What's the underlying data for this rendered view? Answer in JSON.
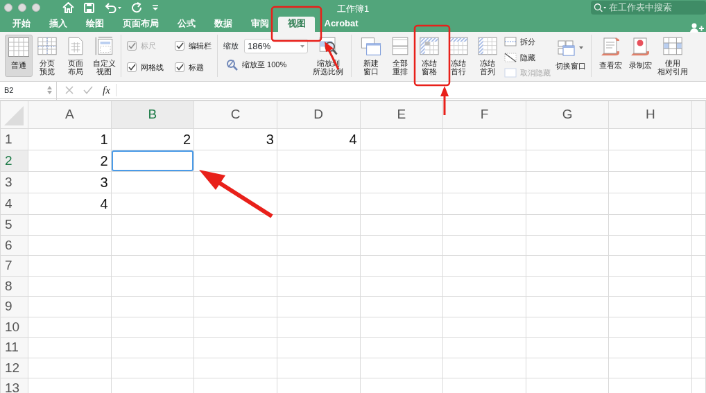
{
  "window": {
    "title": "工作簿1"
  },
  "search": {
    "placeholder": "在工作表中搜索"
  },
  "tabs": [
    {
      "label": "开始",
      "selected": false
    },
    {
      "label": "插入",
      "selected": false
    },
    {
      "label": "绘图",
      "selected": false
    },
    {
      "label": "页面布局",
      "selected": false
    },
    {
      "label": "公式",
      "selected": false
    },
    {
      "label": "数据",
      "selected": false
    },
    {
      "label": "审阅",
      "selected": false
    },
    {
      "label": "视图",
      "selected": true
    },
    {
      "label": "Acrobat",
      "selected": false
    }
  ],
  "ribbon": {
    "views": [
      {
        "lines": [
          "普通"
        ],
        "selected": true
      },
      {
        "lines": [
          "分页",
          "预览"
        ],
        "selected": false
      },
      {
        "lines": [
          "页面",
          "布局"
        ],
        "selected": false
      },
      {
        "lines": [
          "自定义",
          "视图"
        ],
        "selected": false
      }
    ],
    "show": [
      {
        "label": "标尺",
        "checked": true,
        "disabled": true
      },
      {
        "label": "编辑栏",
        "checked": true,
        "disabled": false
      },
      {
        "label": "网格线",
        "checked": true,
        "disabled": false
      },
      {
        "label": "标题",
        "checked": true,
        "disabled": false
      }
    ],
    "zoom": {
      "label": "缩放",
      "value": "186%",
      "reset": "缩放至 100%",
      "fit": [
        "缩放到",
        "所选比例"
      ]
    },
    "window_buttons": [
      {
        "lines": [
          "新建",
          "窗口"
        ]
      },
      {
        "lines": [
          "全部",
          "重排"
        ]
      },
      {
        "lines": [
          "冻结",
          "窗格"
        ]
      },
      {
        "lines": [
          "冻结",
          "首行"
        ]
      },
      {
        "lines": [
          "冻结",
          "首列"
        ]
      }
    ],
    "window_small": [
      {
        "label": "拆分",
        "disabled": false
      },
      {
        "label": "隐藏",
        "disabled": false
      },
      {
        "label": "取消隐藏",
        "disabled": true
      }
    ],
    "switch_windows": "切换窗口",
    "macros": [
      {
        "lines": [
          "查看宏"
        ]
      },
      {
        "lines": [
          "录制宏"
        ]
      },
      {
        "lines": [
          "使用",
          "相对引用"
        ]
      }
    ]
  },
  "formula_bar": {
    "name_box": "B2",
    "fx": "fx"
  },
  "sheet": {
    "columns": [
      {
        "label": "A",
        "selected": false
      },
      {
        "label": "B",
        "selected": true
      },
      {
        "label": "C",
        "selected": false
      },
      {
        "label": "D",
        "selected": false
      },
      {
        "label": "E",
        "selected": false
      },
      {
        "label": "F",
        "selected": false
      },
      {
        "label": "G",
        "selected": false
      },
      {
        "label": "H",
        "selected": false
      }
    ],
    "rows": [
      {
        "label": "1",
        "selected": false,
        "cells": [
          "1",
          "2",
          "3",
          "4"
        ]
      },
      {
        "label": "2",
        "selected": true,
        "cells": [
          "2"
        ]
      },
      {
        "label": "3",
        "selected": false,
        "cells": [
          "3"
        ]
      },
      {
        "label": "4",
        "selected": false,
        "cells": [
          "4"
        ]
      },
      {
        "label": "5",
        "selected": false
      },
      {
        "label": "6",
        "selected": false
      },
      {
        "label": "7",
        "selected": false
      },
      {
        "label": "8",
        "selected": false
      },
      {
        "label": "9",
        "selected": false
      },
      {
        "label": "10",
        "selected": false
      },
      {
        "label": "11",
        "selected": false
      },
      {
        "label": "12",
        "selected": false
      },
      {
        "label": "13",
        "selected": false
      }
    ]
  }
}
